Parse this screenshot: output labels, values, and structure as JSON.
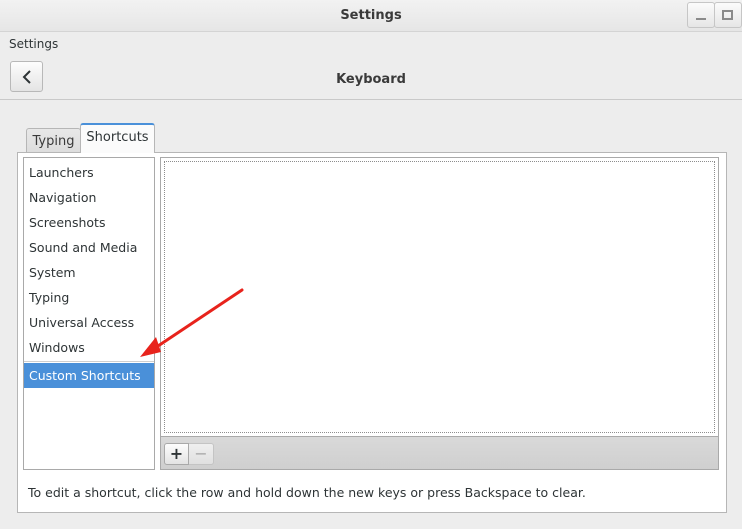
{
  "window": {
    "title": "Settings"
  },
  "header": {
    "app_label": "Settings",
    "panel_title": "Keyboard"
  },
  "tabs": [
    {
      "label": "Typing",
      "active": false
    },
    {
      "label": "Shortcuts",
      "active": true
    }
  ],
  "categories": [
    {
      "label": "Launchers"
    },
    {
      "label": "Navigation"
    },
    {
      "label": "Screenshots"
    },
    {
      "label": "Sound and Media"
    },
    {
      "label": "System"
    },
    {
      "label": "Typing"
    },
    {
      "label": "Universal Access"
    },
    {
      "label": "Windows"
    },
    {
      "label": "Custom Shortcuts",
      "selected": true
    }
  ],
  "toolbar": {
    "add_label": "+",
    "remove_label": "−"
  },
  "hint_text": "To edit a shortcut, click the row and hold down the new keys or press Backspace to clear.",
  "colors": {
    "selection": "#4a90d9",
    "annotation_arrow": "#e8231c"
  }
}
